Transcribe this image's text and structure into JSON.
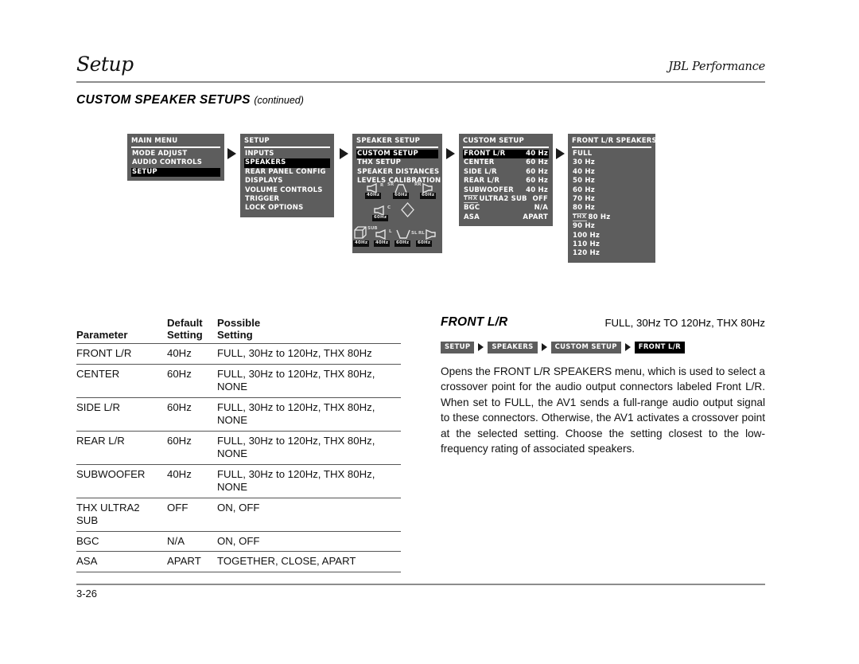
{
  "header": {
    "title": "Setup",
    "brand": "JBL Performance"
  },
  "section": {
    "title": "CUSTOM SPEAKER SETUPS",
    "continued": "(continued)"
  },
  "osd_panels": {
    "main_menu": {
      "title": "MAIN MENU",
      "items": [
        {
          "label": "MODE ADJUST",
          "selected": false
        },
        {
          "label": "AUDIO CONTROLS",
          "selected": false
        },
        {
          "label": "SETUP",
          "selected": true
        }
      ]
    },
    "setup": {
      "title": "SETUP",
      "items": [
        {
          "label": "INPUTS",
          "selected": false
        },
        {
          "label": "SPEAKERS",
          "selected": true
        },
        {
          "label": "REAR PANEL CONFIG",
          "selected": false
        },
        {
          "label": "DISPLAYS",
          "selected": false
        },
        {
          "label": "VOLUME CONTROLS",
          "selected": false
        },
        {
          "label": "TRIGGER",
          "selected": false
        },
        {
          "label": "LOCK OPTIONS",
          "selected": false
        }
      ]
    },
    "speaker_setup": {
      "title": "SPEAKER SETUP",
      "items": [
        {
          "label": "CUSTOM SETUP",
          "selected": true
        },
        {
          "label": "THX SETUP",
          "selected": false
        },
        {
          "label": "SPEAKER DISTANCES",
          "selected": false
        },
        {
          "label": "LEVELS CALIBRATION",
          "selected": false
        }
      ],
      "diagram": {
        "speakers": [
          {
            "position": "front-right",
            "label": "R",
            "freq": "40Hz"
          },
          {
            "position": "surround-right",
            "label": "SR",
            "freq": "60Hz"
          },
          {
            "position": "rear-right",
            "label": "RR",
            "freq": "60Hz"
          },
          {
            "position": "center",
            "label": "C",
            "freq": "60Hz"
          },
          {
            "position": "subwoofer",
            "label": "SUB",
            "freq": "40Hz"
          },
          {
            "position": "front-left",
            "label": "L",
            "freq": "40Hz"
          },
          {
            "position": "surround-left",
            "label": "SL",
            "freq": "60Hz"
          },
          {
            "position": "rear-left",
            "label": "RL",
            "freq": "60Hz"
          }
        ]
      }
    },
    "custom_setup": {
      "title": "CUSTOM SETUP",
      "rows": [
        {
          "label": "FRONT L/R",
          "value": "40 Hz",
          "selected": true,
          "thx": false
        },
        {
          "label": "CENTER",
          "value": "60 Hz",
          "selected": false,
          "thx": false
        },
        {
          "label": "SIDE L/R",
          "value": "60 Hz",
          "selected": false,
          "thx": false
        },
        {
          "label": "REAR L/R",
          "value": "60 Hz",
          "selected": false,
          "thx": false
        },
        {
          "label": "SUBWOOFER",
          "value": "40 Hz",
          "selected": false,
          "thx": false
        },
        {
          "label": "ULTRA2 SUB",
          "value": "OFF",
          "selected": false,
          "thx": true
        },
        {
          "label": "BGC",
          "value": "N/A",
          "selected": false,
          "thx": false
        },
        {
          "label": "ASA",
          "value": "APART",
          "selected": false,
          "thx": false
        }
      ]
    },
    "front_lr_speakers": {
      "title": "FRONT L/R SPEAKERS",
      "items": [
        {
          "label": "FULL",
          "thx": false
        },
        {
          "label": "30 Hz",
          "thx": false
        },
        {
          "label": "40 Hz",
          "thx": false
        },
        {
          "label": "50 Hz",
          "thx": false
        },
        {
          "label": "60 Hz",
          "thx": false
        },
        {
          "label": "70 Hz",
          "thx": false
        },
        {
          "label": "80 Hz",
          "thx": false
        },
        {
          "label": "80 Hz",
          "thx": true
        },
        {
          "label": "90 Hz",
          "thx": false
        },
        {
          "label": "100 Hz",
          "thx": false
        },
        {
          "label": "110 Hz",
          "thx": false
        },
        {
          "label": "120 Hz",
          "thx": false
        }
      ]
    }
  },
  "param_table": {
    "headers": [
      "Parameter",
      "Default\nSetting",
      "Possible\nSetting"
    ],
    "header_parameter": "Parameter",
    "header_default_l1": "Default",
    "header_default_l2": "Setting",
    "header_possible_l1": "Possible",
    "header_possible_l2": "Setting",
    "rows": [
      {
        "parameter": "FRONT L/R",
        "default": "40Hz",
        "possible": "FULL, 30Hz to 120Hz, THX 80Hz"
      },
      {
        "parameter": "CENTER",
        "default": "60Hz",
        "possible": "FULL, 30Hz to 120Hz, THX 80Hz, NONE"
      },
      {
        "parameter": "SIDE L/R",
        "default": "60Hz",
        "possible": "FULL, 30Hz to 120Hz, THX 80Hz, NONE"
      },
      {
        "parameter": "REAR L/R",
        "default": "60Hz",
        "possible": "FULL, 30Hz to 120Hz, THX 80Hz, NONE"
      },
      {
        "parameter": "SUBWOOFER",
        "default": "40Hz",
        "possible": "FULL, 30Hz to 120Hz, THX 80Hz, NONE"
      },
      {
        "parameter": "THX ULTRA2 SUB",
        "default": "OFF",
        "possible": "ON, OFF"
      },
      {
        "parameter": "BGC",
        "default": "N/A",
        "possible": "ON, OFF"
      },
      {
        "parameter": "ASA",
        "default": "APART",
        "possible": "TOGETHER, CLOSE, APART"
      }
    ]
  },
  "right_column": {
    "title": "FRONT L/R",
    "values": "FULL, 30Hz TO 120Hz, THX 80Hz",
    "breadcrumb": [
      {
        "label": "SETUP",
        "active": false
      },
      {
        "label": "SPEAKERS",
        "active": false
      },
      {
        "label": "CUSTOM SETUP",
        "active": false
      },
      {
        "label": "FRONT L/R",
        "active": true
      }
    ],
    "body": "Opens the FRONT L/R SPEAKERS menu, which is used to select a crossover point for the audio output connectors labeled Front L/R. When set to FULL, the AV1 sends a full-range audio output signal to these connectors. Otherwise, the AV1 activates a crossover point at the selected setting. Choose the setting closest to the low-frequency rating of associated speakers."
  },
  "footer": {
    "page_number": "3-26"
  },
  "colors": {
    "osd_background": "#5d5d5d",
    "osd_selected": "#000000",
    "osd_text": "#ffffff",
    "rule": "#8c8c8c",
    "page_text": "#111111"
  }
}
